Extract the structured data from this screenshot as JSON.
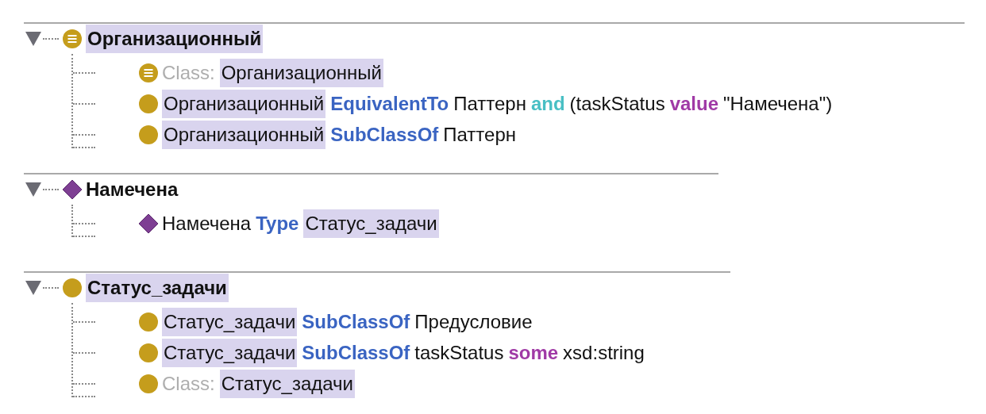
{
  "blocks": [
    {
      "expanded": true,
      "kind": "defined-class",
      "heading": {
        "kind": "entity",
        "text": "Организационный"
      },
      "lines": [
        {
          "kind": "defined-class",
          "tokens": [
            {
              "kind": "label",
              "text": "Class:"
            },
            {
              "kind": "entity",
              "text": "Организационный"
            }
          ]
        },
        {
          "kind": "class",
          "tokens": [
            {
              "kind": "entity",
              "text": "Организационный"
            },
            {
              "kind": "keyword",
              "text": "EquivalentTo"
            },
            {
              "kind": "plain",
              "text": "Паттерн"
            },
            {
              "kind": "connective",
              "text": "and"
            },
            {
              "kind": "plain",
              "text": "(taskStatus"
            },
            {
              "kind": "restriction",
              "text": "value"
            },
            {
              "kind": "plain",
              "text": "\"Намечена\")"
            }
          ]
        },
        {
          "kind": "class",
          "tokens": [
            {
              "kind": "entity",
              "text": "Организационный"
            },
            {
              "kind": "keyword",
              "text": "SubClassOf"
            },
            {
              "kind": "plain",
              "text": "Паттерн"
            }
          ]
        }
      ]
    },
    {
      "expanded": true,
      "kind": "individual",
      "heading": {
        "kind": "plain",
        "text": "Намечена"
      },
      "lines": [
        {
          "kind": "individual",
          "tokens": [
            {
              "kind": "plain",
              "text": "Намечена"
            },
            {
              "kind": "keyword",
              "text": "Type"
            },
            {
              "kind": "entity",
              "text": "Статус_задачи"
            }
          ]
        }
      ]
    },
    {
      "expanded": true,
      "kind": "class",
      "heading": {
        "kind": "entity",
        "text": "Статус_задачи"
      },
      "lines": [
        {
          "kind": "class",
          "tokens": [
            {
              "kind": "entity",
              "text": "Статус_задачи"
            },
            {
              "kind": "keyword",
              "text": "SubClassOf"
            },
            {
              "kind": "plain",
              "text": "Предусловие"
            }
          ]
        },
        {
          "kind": "class",
          "tokens": [
            {
              "kind": "entity",
              "text": "Статус_задачи"
            },
            {
              "kind": "keyword",
              "text": "SubClassOf"
            },
            {
              "kind": "plain",
              "text": "taskStatus"
            },
            {
              "kind": "restriction",
              "text": "some"
            },
            {
              "kind": "plain",
              "text": "xsd:string"
            }
          ]
        },
        {
          "kind": "class",
          "tokens": [
            {
              "kind": "label",
              "text": "Class:"
            },
            {
              "kind": "entity",
              "text": "Статус_задачи"
            }
          ]
        }
      ]
    }
  ]
}
